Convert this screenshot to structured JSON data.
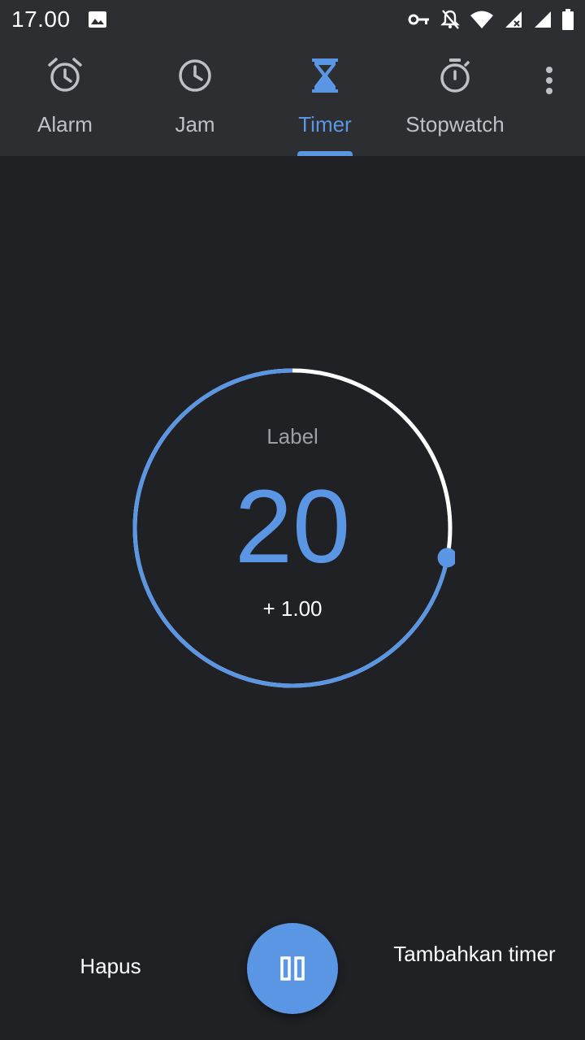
{
  "status_bar": {
    "time": "17.00",
    "icons": [
      "image-icon",
      "vpn-key-icon",
      "notifications-off-icon",
      "wifi-icon",
      "signal-x-icon",
      "signal-icon",
      "battery-icon"
    ]
  },
  "tabs": [
    {
      "label": "Alarm",
      "icon": "alarm-icon",
      "active": false
    },
    {
      "label": "Jam",
      "icon": "clock-icon",
      "active": false
    },
    {
      "label": "Timer",
      "icon": "hourglass-icon",
      "active": true
    },
    {
      "label": "Stopwatch",
      "icon": "stopwatch-icon",
      "active": false
    }
  ],
  "timer": {
    "label": "Label",
    "value": "20",
    "add_minute": "+ 1.00",
    "progress_remaining_fraction": 0.72
  },
  "actions": {
    "delete": "Hapus",
    "add_timer": "Tambahkan timer",
    "pause_icon": "pause-icon"
  },
  "colors": {
    "accent": "#5a96e3",
    "background": "#202124",
    "bar": "#2d2e31",
    "ring_track": "#ffffff"
  }
}
